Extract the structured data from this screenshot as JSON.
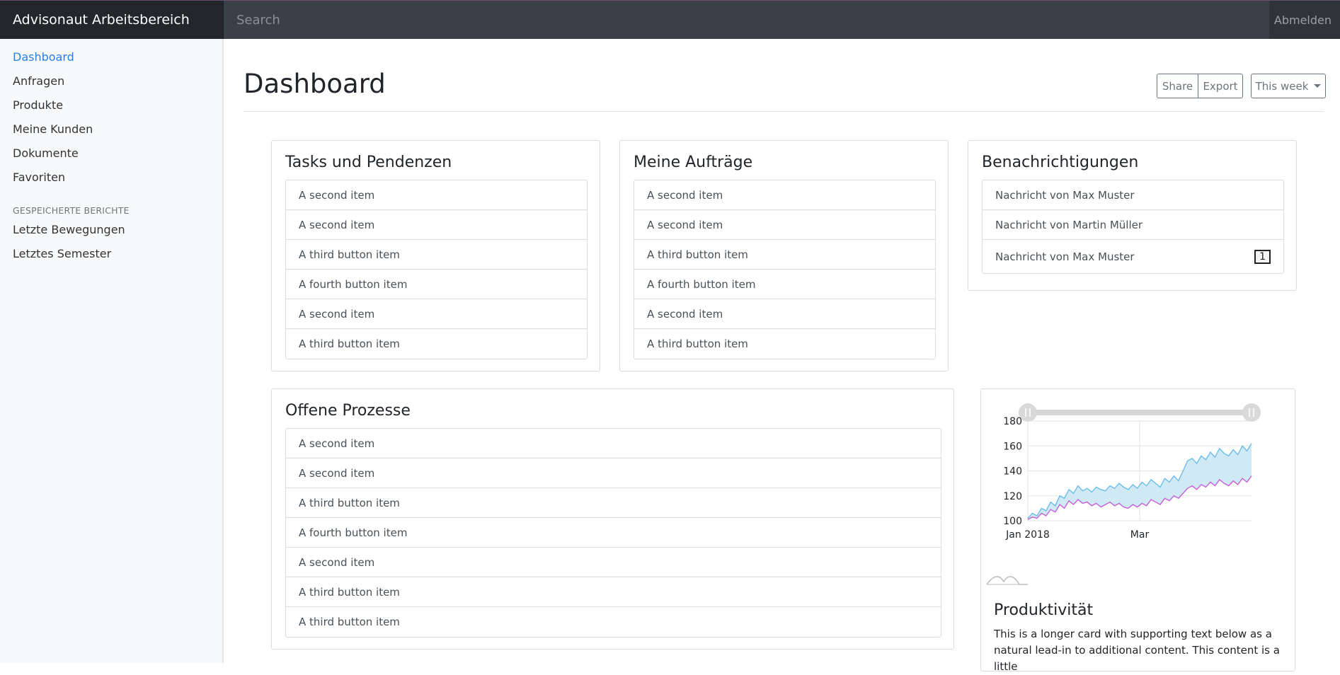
{
  "topbar": {
    "brand": "Advisonaut Arbeitsbereich",
    "search_placeholder": "Search",
    "signout": "Abmelden"
  },
  "sidebar": {
    "items": [
      {
        "label": "Dashboard",
        "active": true
      },
      {
        "label": "Anfragen"
      },
      {
        "label": "Produkte"
      },
      {
        "label": "Meine Kunden"
      },
      {
        "label": "Dokumente"
      },
      {
        "label": "Favoriten"
      }
    ],
    "heading": "GESPEICHERTE BERICHTE",
    "reports": [
      {
        "label": "Letzte Bewegungen"
      },
      {
        "label": "Letztes Semester"
      }
    ]
  },
  "header": {
    "title": "Dashboard",
    "share": "Share",
    "export": "Export",
    "period": "This week"
  },
  "cards": {
    "tasks": {
      "title": "Tasks und Pendenzen",
      "items": [
        "A second item",
        "A second item",
        "A third button item",
        "A fourth button item",
        "A second item",
        "A third button item"
      ]
    },
    "orders": {
      "title": "Meine Aufträge",
      "items": [
        "A second item",
        "A second item",
        "A third button item",
        "A fourth button item",
        "A second item",
        "A third button item"
      ]
    },
    "notifications": {
      "title": "Benachrichtigungen",
      "items": [
        "Nachricht von Max Muster",
        "Nachricht von Martin Müller",
        "Nachricht von Max Muster"
      ],
      "badge": "1"
    },
    "processes": {
      "title": "Offene Prozesse",
      "items": [
        "A second item",
        "A second item",
        "A third button item",
        "A fourth button item",
        "A second item",
        "A third button item",
        "A third button item"
      ]
    },
    "productivity": {
      "title": "Produktivität",
      "text": "This is a longer card with supporting text below as a natural lead-in to additional content. This content is a little"
    }
  },
  "colors": {
    "accent": "#2b7de0",
    "upper_series": "#6bbde8",
    "lower_series": "#c55fd6",
    "band_fill": "#cfe9f5"
  },
  "chart_data": {
    "type": "area",
    "x_tick_labels": [
      "Jan 2018",
      "Mar"
    ],
    "y_ticks": [
      100,
      120,
      140,
      160,
      180
    ],
    "ylim": [
      100,
      180
    ],
    "grid": true,
    "series": [
      {
        "values": [
          102,
          106,
          104,
          110,
          108,
          115,
          112,
          120,
          118,
          125,
          122,
          128,
          124,
          126,
          123,
          127,
          125,
          124,
          128,
          126,
          130,
          127,
          125,
          129,
          126,
          131,
          128,
          133,
          130,
          127,
          134,
          131,
          136,
          132,
          140,
          148,
          150,
          146,
          152,
          149,
          155,
          151,
          158,
          154,
          152,
          157,
          153,
          160,
          156,
          162
        ]
      },
      {
        "values": [
          101,
          103,
          102,
          106,
          104,
          109,
          107,
          113,
          110,
          116,
          113,
          117,
          114,
          115,
          112,
          114,
          111,
          113,
          115,
          112,
          114,
          111,
          110,
          113,
          111,
          114,
          112,
          117,
          115,
          113,
          118,
          116,
          120,
          118,
          122,
          126,
          128,
          125,
          129,
          127,
          131,
          128,
          133,
          130,
          128,
          132,
          129,
          134,
          131,
          136
        ]
      }
    ]
  }
}
